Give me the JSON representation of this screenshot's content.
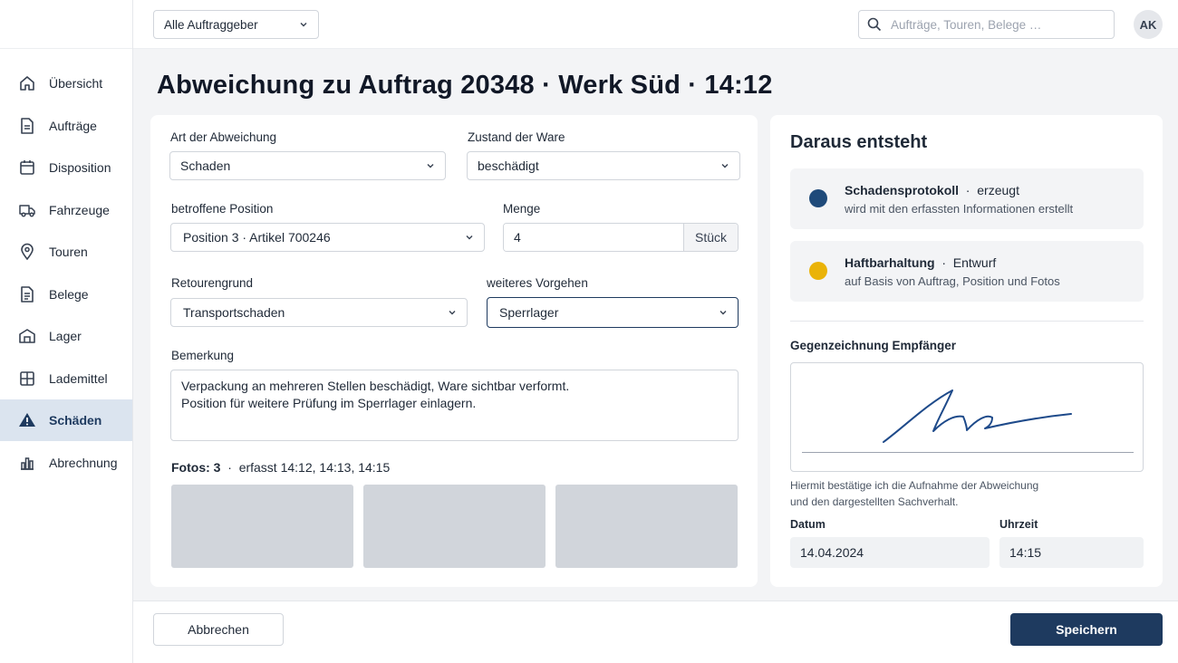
{
  "header": {
    "client_select": "Alle Auftraggeber",
    "search_placeholder": "Aufträge, Touren, Belege …",
    "avatar_initials": "AK"
  },
  "sidebar": {
    "items": [
      {
        "label": "Übersicht",
        "icon": "home-icon"
      },
      {
        "label": "Aufträge",
        "icon": "document-icon"
      },
      {
        "label": "Disposition",
        "icon": "calendar-icon"
      },
      {
        "label": "Fahrzeuge",
        "icon": "truck-icon"
      },
      {
        "label": "Touren",
        "icon": "map-pin-icon"
      },
      {
        "label": "Belege",
        "icon": "receipt-icon"
      },
      {
        "label": "Lager",
        "icon": "warehouse-icon"
      },
      {
        "label": "Lademittel",
        "icon": "pallet-icon"
      },
      {
        "label": "Schäden",
        "icon": "warning-icon",
        "active": true
      },
      {
        "label": "Abrechnung",
        "icon": "bar-chart-icon"
      }
    ]
  },
  "page": {
    "title": "Abweichung zu Auftrag 20348 · Werk Süd · 14:12"
  },
  "form": {
    "art_label": "Art der Abweichung",
    "art_value": "Schaden",
    "zustand_label": "Zustand der Ware",
    "zustand_value": "beschädigt",
    "position_label": "betroffene Position",
    "position_value": "Position 3 · Artikel 700246",
    "menge_label": "Menge",
    "menge_value": "4",
    "menge_unit": "Stück",
    "retourengrund_label": "Retourengrund",
    "retourengrund_value": "Transportschaden",
    "vorgehen_label": "weiteres Vorgehen",
    "vorgehen_value": "Sperrlager",
    "bemerkung_label": "Bemerkung",
    "bemerkung_line1": "Verpackung an mehreren Stellen beschädigt, Ware sichtbar verformt.",
    "bemerkung_line2": "Position für weitere Prüfung im Sperrlager einlagern.",
    "fotos_label": "Fotos: 3",
    "fotos_times": "erfasst 14:12, 14:13, 14:15",
    "photo_count": 3
  },
  "result": {
    "title": "Daraus entsteht",
    "items": [
      {
        "name": "Schadensprotokoll",
        "status": "erzeugt",
        "desc": "wird mit den erfassten Informationen erstellt",
        "color": "#1e4a7a"
      },
      {
        "name": "Haftbarhaltung",
        "status": "Entwurf",
        "desc": "auf Basis von Auftrag, Position und Fotos",
        "color": "#eab308"
      }
    ],
    "signature_label": "Gegenzeichnung Empfänger",
    "confirm_line1": "Hiermit bestätige ich die Aufnahme der Abweichung",
    "confirm_line2": "und den dargestellten Sachverhalt.",
    "datum_label": "Datum",
    "datum_value": "14.04.2024",
    "uhrzeit_label": "Uhrzeit",
    "uhrzeit_value": "14:15"
  },
  "footer": {
    "cancel_label": "Abbrechen",
    "save_label": "Speichern"
  },
  "colors": {
    "accent": "#1e3a5f",
    "active_nav_bg": "#dbe4ef",
    "photo_placeholder": "#d1d5db"
  }
}
